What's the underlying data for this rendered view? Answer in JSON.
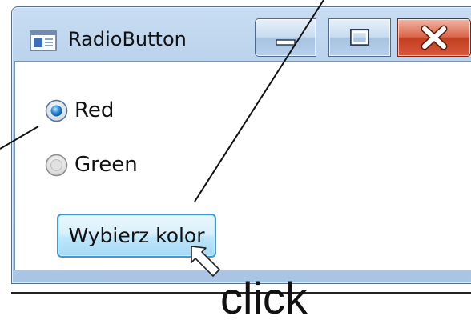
{
  "window": {
    "title": "RadioButton"
  },
  "radios": [
    {
      "label": "Red",
      "checked": true
    },
    {
      "label": "Green",
      "checked": false
    }
  ],
  "button": {
    "label": "Wybierz kolor"
  },
  "annotation": {
    "caption": "click"
  },
  "colors": {
    "accent": "#3c9bd0",
    "close": "#c33f22",
    "frame": "#b4cde9"
  },
  "icons": {
    "app": "app-window-icon",
    "minimize": "minimize-icon",
    "maximize": "maximize-icon",
    "close": "close-icon",
    "cursor": "arrow-cursor-icon"
  }
}
